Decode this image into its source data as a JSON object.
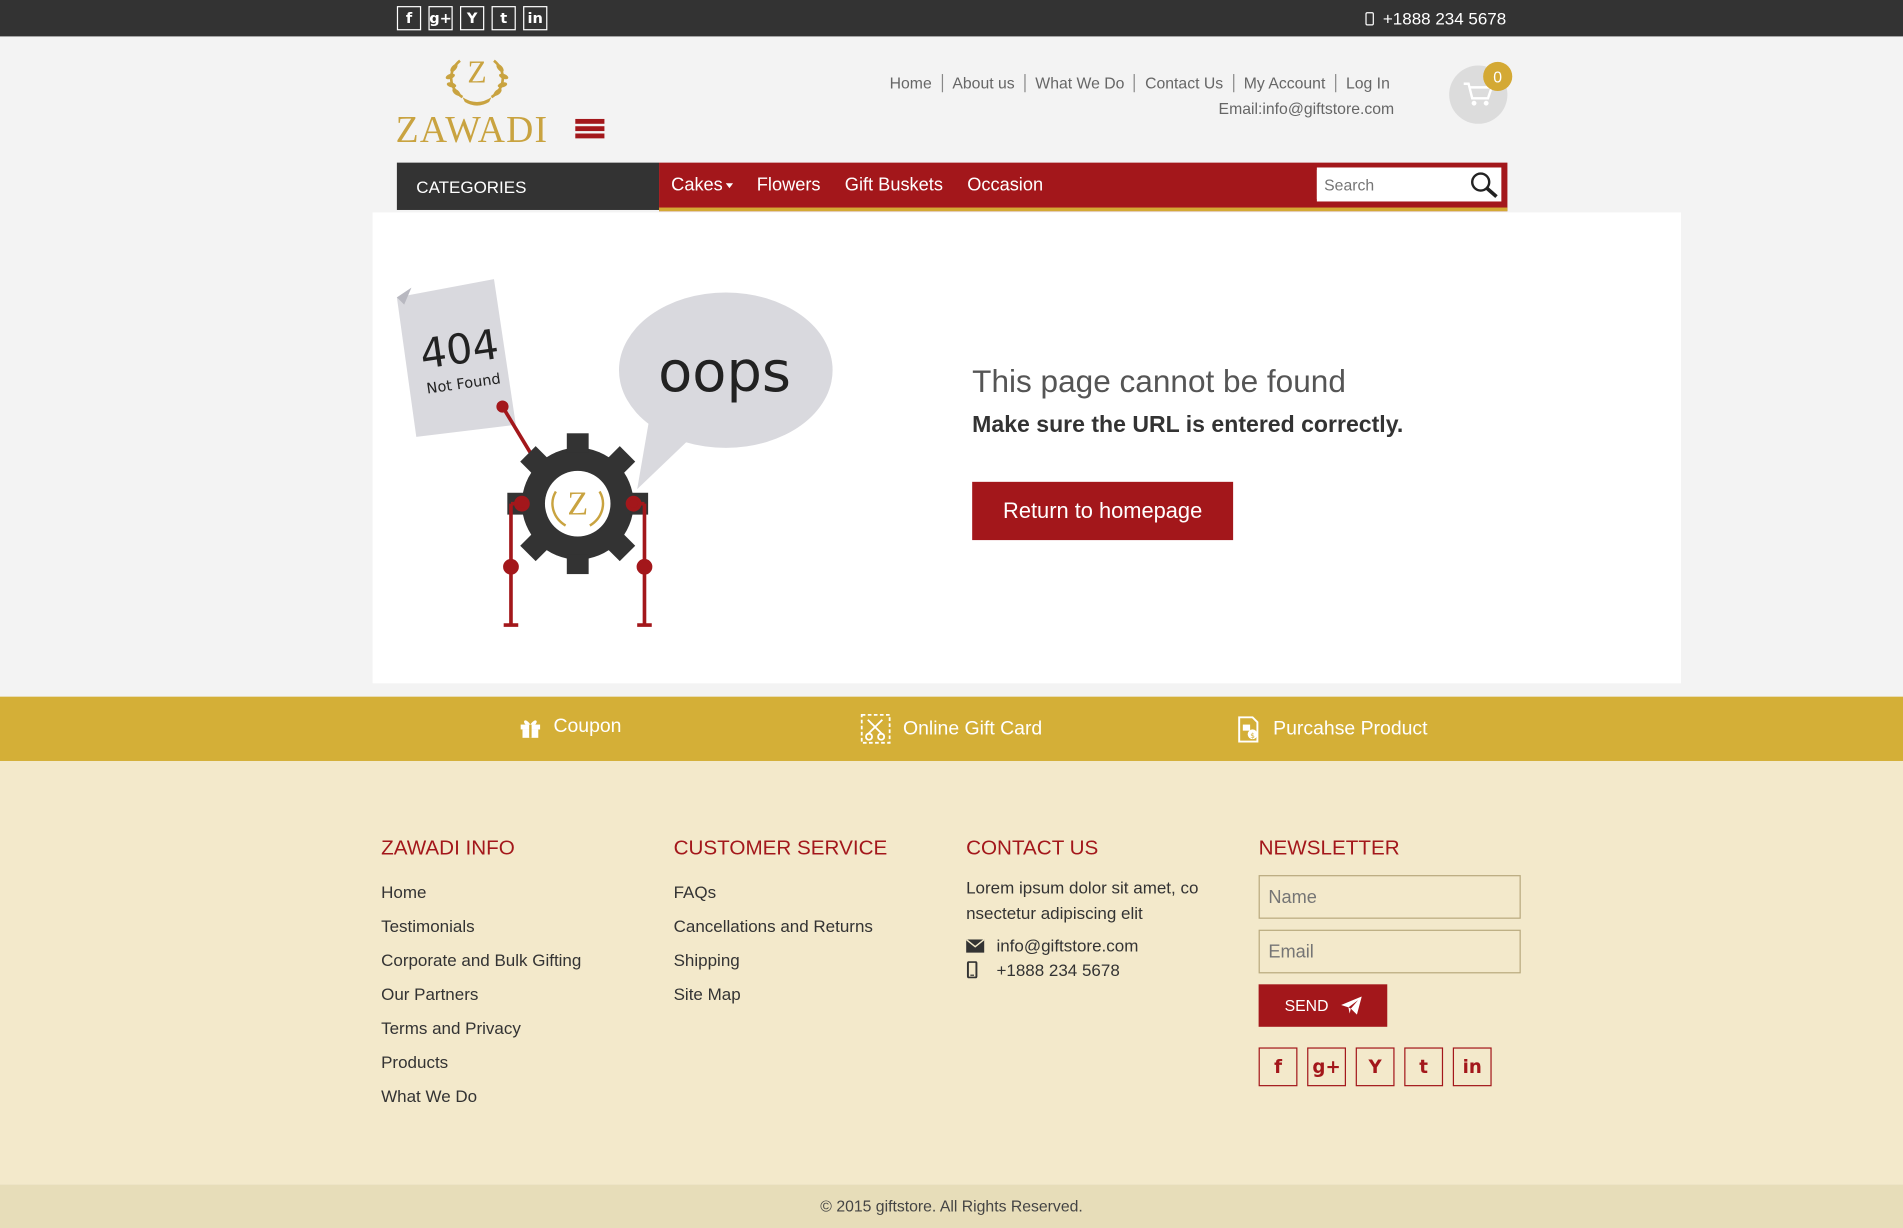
{
  "topbar": {
    "social": [
      {
        "icon": "facebook-icon",
        "glyph": "f"
      },
      {
        "icon": "google-plus-icon",
        "glyph": "g+"
      },
      {
        "icon": "yahoo-icon",
        "glyph": "Y"
      },
      {
        "icon": "tumblr-icon",
        "glyph": "t"
      },
      {
        "icon": "linkedin-icon",
        "glyph": "in"
      }
    ],
    "phone": "+1888 234 5678"
  },
  "header": {
    "logo_text": "ZAWADI",
    "nav": [
      "Home",
      "About us",
      "What We Do",
      "Contact Us",
      "My Account",
      "Log In"
    ],
    "email": "Email:info@giftstore.com",
    "cart_count": "0"
  },
  "navbar": {
    "categories_label": "CATEGORIES",
    "items": [
      "Cakes",
      "Flowers",
      "Gift Buskets",
      "Occasion"
    ],
    "search_placeholder": "Search"
  },
  "error": {
    "code": "404",
    "code_sub": "Not Found",
    "bubble": "oops",
    "title": "This page cannot be found",
    "subtitle": "Make sure the URL is entered correctly.",
    "button": "Return to homepage"
  },
  "strip": {
    "coupon": "Coupon",
    "gift_card": "Online Gift Card",
    "purchase": "Purcahse Product"
  },
  "footer": {
    "info_title": "ZAWADI INFO",
    "info_links": [
      "Home",
      "Testimonials",
      "Corporate and Bulk Gifting",
      "Our Partners",
      "Terms and Privacy",
      "Products",
      "What We Do"
    ],
    "service_title": "CUSTOMER SERVICE",
    "service_links": [
      "FAQs",
      "Cancellations and Returns",
      "Shipping",
      "Site Map"
    ],
    "contact_title": "CONTACT US",
    "contact_text_1": "Lorem ipsum dolor sit amet, co",
    "contact_text_2": "nsectetur adipiscing elit",
    "contact_email": "info@giftstore.com",
    "contact_phone": "+1888 234 5678",
    "newsletter_title": "NEWSLETTER",
    "name_placeholder": "Name",
    "email_placeholder": "Email",
    "send_label": "SEND",
    "copyright": "© 2015 giftstore. All Rights Reserved."
  },
  "colors": {
    "brand_red": "#a3171b",
    "gold": "#d4af37",
    "dark": "#333333",
    "footer_bg": "#f3e9cb"
  }
}
